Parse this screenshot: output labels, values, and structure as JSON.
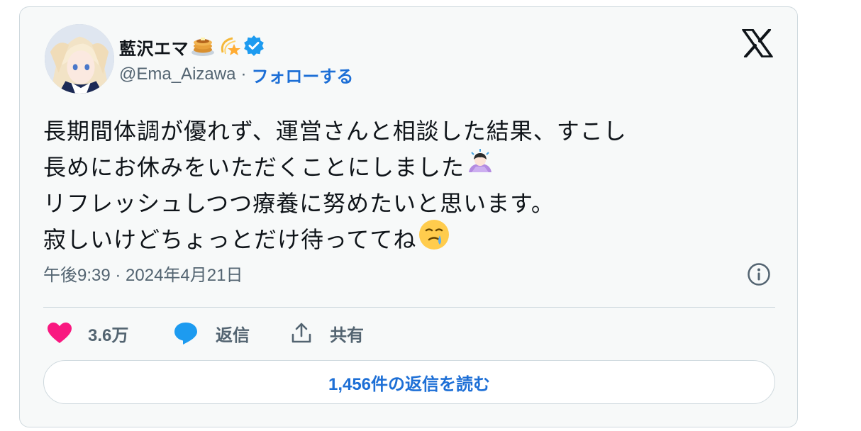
{
  "author": {
    "display_name": "藍沢エマ",
    "name_emojis": [
      "pancakes-emoji",
      "dizzy-star-emoji"
    ],
    "verified": true,
    "handle": "@Ema_Aizawa",
    "separator": "·",
    "follow_label": "フォローする"
  },
  "tweet": {
    "lines": [
      "長期間体調が優れず、運営さんと相談した結果、すこし",
      "長めにお休みをいただくことにしました",
      "リフレッシュしつつ療養に努めたいと思います。",
      "寂しいけどちょっとだけ待っててね"
    ],
    "line2_emoji": "person-bowing-emoji",
    "line4_emoji": "face-holding-back-tears-emoji"
  },
  "timestamp": "午後9:39 · 2024年4月21日",
  "actions": {
    "like_count": "3.6万",
    "reply_label": "返信",
    "share_label": "共有"
  },
  "read_replies_label": "1,456件の返信を読む",
  "colors": {
    "accent": "#1d6fd6",
    "like": "#f91880",
    "reply": "#1d9bf0",
    "text": "#0f1419",
    "muted": "#536471",
    "border": "#cfd9de"
  }
}
